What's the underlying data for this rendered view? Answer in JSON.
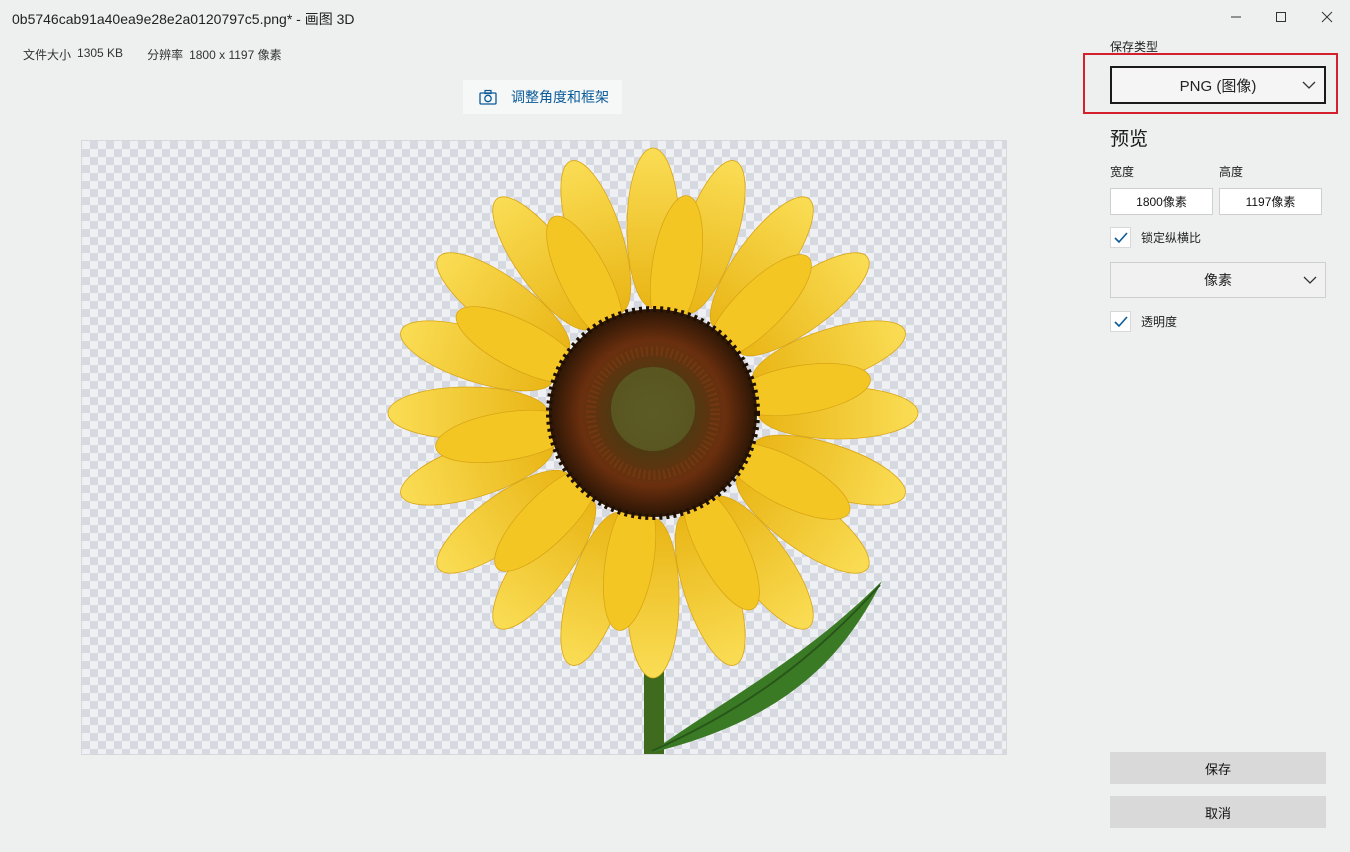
{
  "window": {
    "title": "0b5746cab91a40ea9e28e2a0120797c5.png* - 画图 3D"
  },
  "file_info": {
    "size_label": "文件大小",
    "size_value": "1305 KB",
    "resolution_label": "分辨率",
    "resolution_value": "1800 x 1197 像素"
  },
  "toolbar": {
    "adjust_label": "调整角度和框架"
  },
  "panel": {
    "save_type_label": "保存类型",
    "save_type_value": "PNG (图像)",
    "preview_heading": "预览",
    "width_label": "宽度",
    "height_label": "高度",
    "width_value": "1800像素",
    "height_value": "1197像素",
    "lock_ratio_label": "锁定纵横比",
    "lock_ratio_checked": true,
    "unit_value": "像素",
    "transparency_label": "透明度",
    "transparency_checked": true,
    "save_button": "保存",
    "cancel_button": "取消"
  },
  "colors": {
    "accent_link": "#0a5a98",
    "highlight_box": "#d4202c",
    "petal": "#f6c82a",
    "center": "#4a2a10"
  }
}
